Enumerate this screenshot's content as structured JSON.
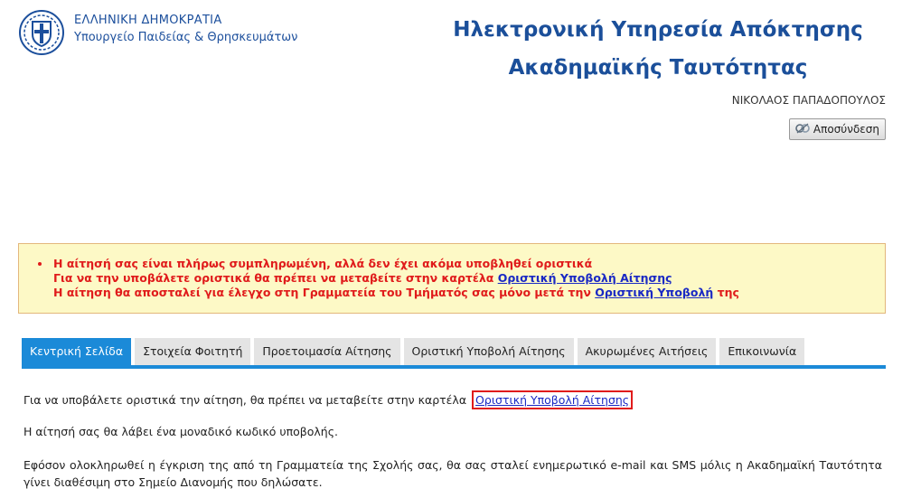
{
  "header": {
    "logo_line1": "ΕΛΛΗΝΙΚΗ ΔΗΜΟΚΡΑΤΙΑ",
    "logo_line2": "Υπουργείο Παιδείας & Θρησκευμάτων",
    "title_line1": "Ηλεκτρονική Υπηρεσία Απόκτησης",
    "title_line2": "Ακαδημαϊκής Ταυτότητας",
    "user_name": "ΝΙΚΟΛΑΟΣ ΠΑΠΑΔΟΠΟΥΛΟΣ",
    "logout_label": "Αποσύνδεση"
  },
  "notice": {
    "line1": "Η αίτησή σας είναι πλήρως συμπληρωμένη, αλλά δεν έχει ακόμα υποβληθεί οριστικά",
    "line2_prefix": "Για να την υποβάλετε οριστικά θα πρέπει να μεταβείτε στην καρτέλα",
    "line2_link": "Οριστική Υποβολή Αίτησης",
    "line3_prefix": "Η αίτηση θα αποσταλεί για έλεγχο στη Γραμματεία του Τμήματός σας μόνο μετά την",
    "line3_link": "Οριστική Υποβολή",
    "line3_suffix": "της"
  },
  "tabs": [
    {
      "label": "Κεντρική Σελίδα",
      "active": true
    },
    {
      "label": "Στοιχεία Φοιτητή",
      "active": false
    },
    {
      "label": "Προετοιμασία Αίτησης",
      "active": false
    },
    {
      "label": "Οριστική Υποβολή Αίτησης",
      "active": false
    },
    {
      "label": "Ακυρωμένες Αιτήσεις",
      "active": false
    },
    {
      "label": "Επικοινωνία",
      "active": false
    }
  ],
  "content": {
    "p1_prefix": "Για να υποβάλετε οριστικά την αίτηση, θα πρέπει να μεταβείτε στην καρτέλα",
    "p1_link": "Οριστική Υποβολή Αίτησης",
    "p2": "Η αίτησή σας θα λάβει ένα μοναδικό κωδικό υποβολής.",
    "p3": "Εφόσον ολοκληρωθεί η έγκριση της από τη Γραμματεία της Σχολής σας, θα σας σταλεί ενημερωτικό e-mail και SMS μόλις η Ακαδημαϊκή Ταυτότητα γίνει διαθέσιμη στο Σημείο Διανομής που δηλώσατε."
  },
  "colors": {
    "brand_blue": "#1b4f9a",
    "tab_active": "#1b8ad8",
    "notice_bg": "#fdf9c6",
    "notice_text": "#e01b1b",
    "link": "#1a29c4"
  },
  "icons": {
    "logo": "greek-coat-of-arms-icon",
    "logout": "logout-icon"
  }
}
